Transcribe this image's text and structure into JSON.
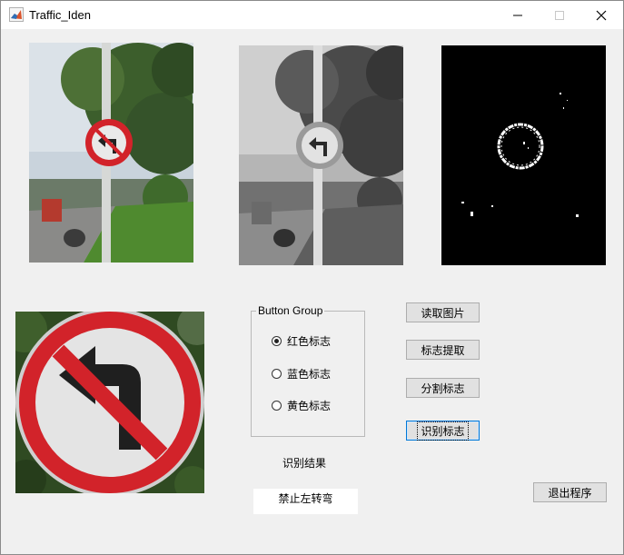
{
  "window": {
    "title": "Traffic_Iden",
    "icon": "matlab-icon",
    "controls": [
      "minimize-icon",
      "maximize-icon",
      "close-icon"
    ]
  },
  "images": [
    {
      "name": "original-image",
      "content": "color photo of no-left-turn sign on pole"
    },
    {
      "name": "grayscale-image",
      "content": "grayscale photo of sign"
    },
    {
      "name": "binary-image",
      "content": "binary mask showing red ring"
    },
    {
      "name": "extracted-sign-image",
      "content": "cropped no-left-turn sign"
    }
  ],
  "button_group": {
    "title": "Button Group",
    "options": [
      {
        "label": "红色标志",
        "selected": true
      },
      {
        "label": "蓝色标志",
        "selected": false
      },
      {
        "label": "黄色标志",
        "selected": false
      }
    ]
  },
  "buttons": {
    "read_image": "读取图片",
    "extract_sign": "标志提取",
    "segment_sign": "分割标志",
    "recognize_sign": "识别标志",
    "exit_program": "退出程序"
  },
  "result": {
    "label": "识别结果",
    "value": "禁止左转弯"
  },
  "colors": {
    "sign_red": "#d2232a",
    "window_bg": "#f0f0f0",
    "focus_blue": "#0078d7"
  }
}
